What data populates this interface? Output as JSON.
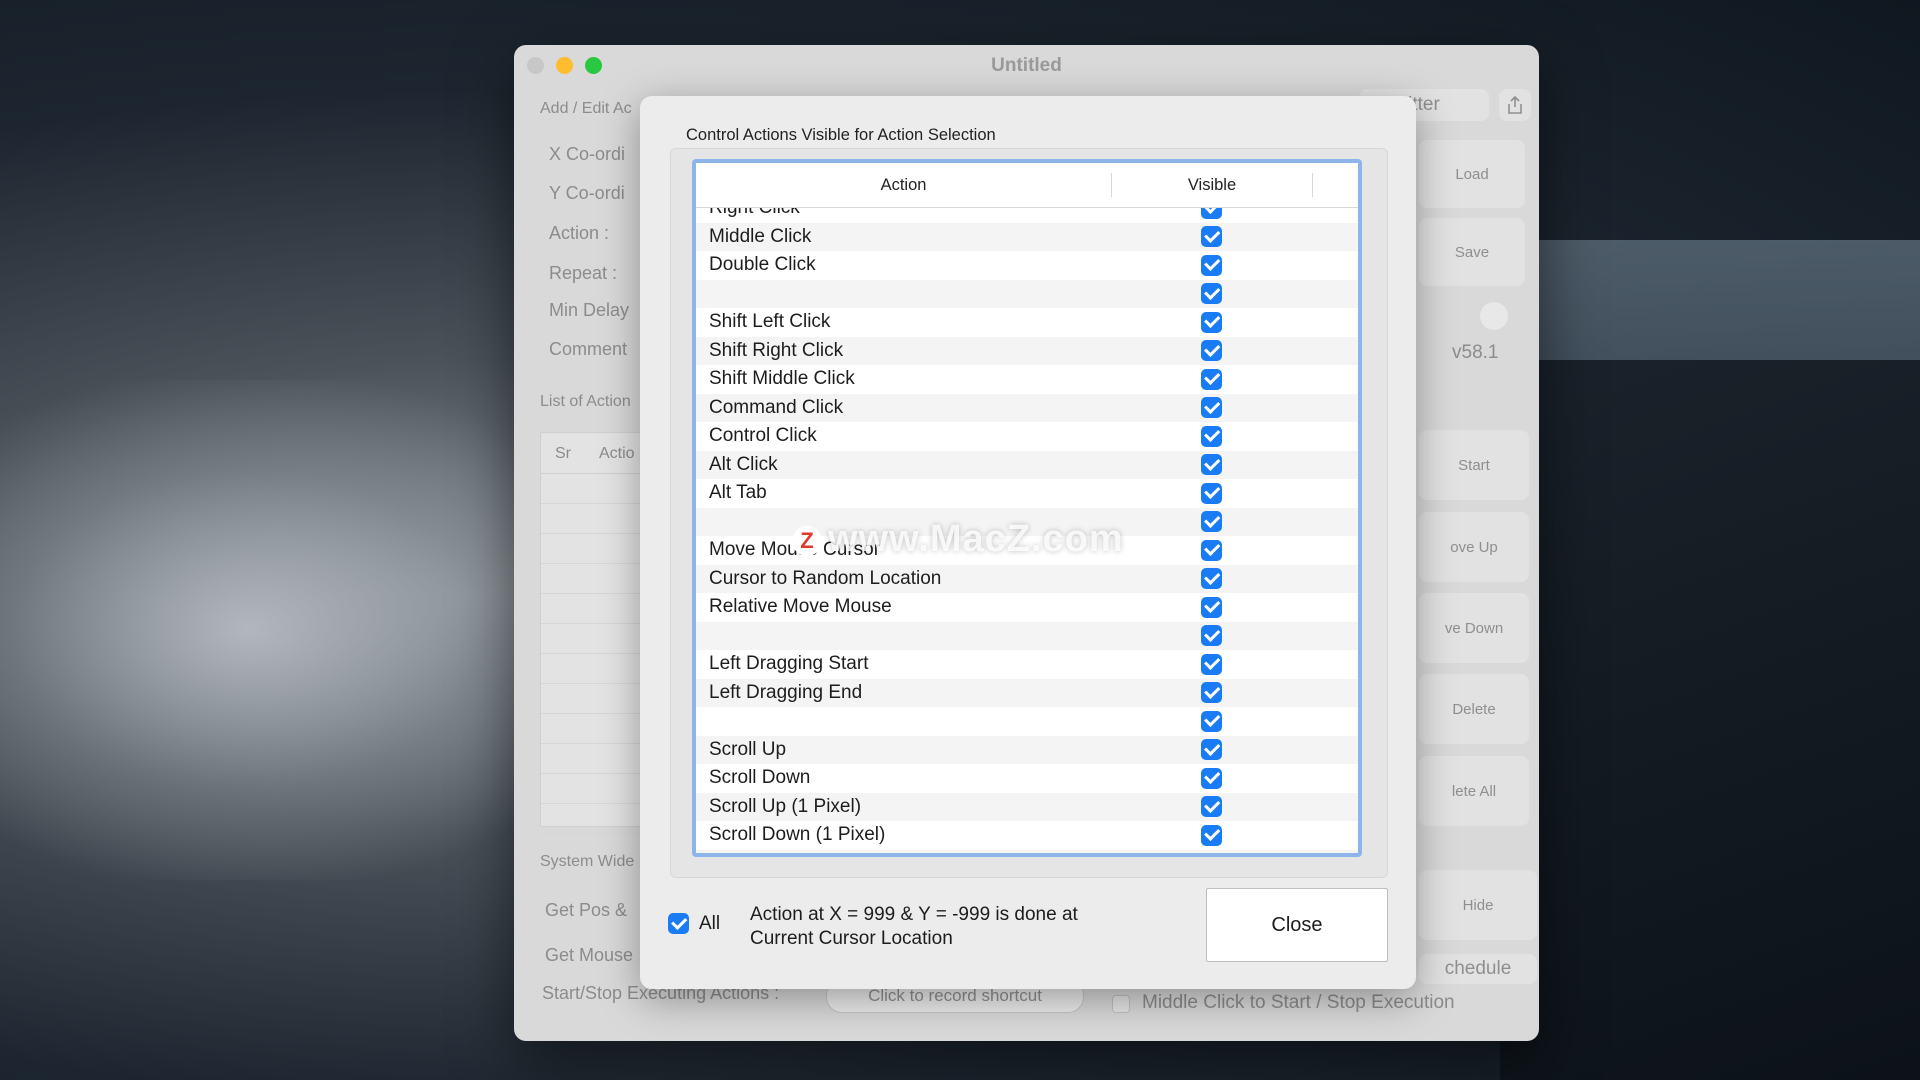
{
  "window": {
    "title": "Untitled"
  },
  "background_window": {
    "add_edit_label": "Add / Edit Ac",
    "x_label": "X Co-ordi",
    "y_label": "Y Co-ordi",
    "action_label": "Action :",
    "repeat_label": "Repeat :",
    "min_delay_label": "Min Delay",
    "comment_label": "Comment",
    "list_label": "List of Action",
    "list_col_sr": "Sr",
    "list_col_action": "Actio",
    "system_wide_label": "System Wide",
    "get_pos_label": "Get Pos &",
    "get_mouse_label": "Get Mouse",
    "start_stop_label": "Start/Stop Executing Actions :",
    "record_shortcut_label": "Click to record shortcut",
    "jitter_label": "itter",
    "load_label": "Load",
    "save_label": "Save",
    "version": "v58.1",
    "start_label": "Start",
    "move_up_label": "ove Up",
    "move_down_label": "ve Down",
    "delete_label": "Delete",
    "delete_all_label": "lete All",
    "hide_label": "Hide",
    "schedule_label": "chedule",
    "middle_click_label": "Middle Click to Start / Stop Execution"
  },
  "dialog": {
    "title": "Control Actions Visible for Action Selection",
    "columns": {
      "action": "Action",
      "visible": "Visible"
    },
    "rows": [
      {
        "action": "Right Click",
        "visible": true
      },
      {
        "action": "Middle Click",
        "visible": true
      },
      {
        "action": "Double Click",
        "visible": true
      },
      {
        "action": "",
        "visible": true
      },
      {
        "action": "Shift Left Click",
        "visible": true
      },
      {
        "action": "Shift Right Click",
        "visible": true
      },
      {
        "action": "Shift Middle Click",
        "visible": true
      },
      {
        "action": "Command Click",
        "visible": true
      },
      {
        "action": "Control Click",
        "visible": true
      },
      {
        "action": "Alt Click",
        "visible": true
      },
      {
        "action": "Alt Tab",
        "visible": true
      },
      {
        "action": "",
        "visible": true
      },
      {
        "action": "Move Mouse Cursor",
        "visible": true
      },
      {
        "action": "Cursor to Random Location",
        "visible": true
      },
      {
        "action": "Relative Move Mouse",
        "visible": true
      },
      {
        "action": "",
        "visible": true
      },
      {
        "action": "Left Dragging Start",
        "visible": true
      },
      {
        "action": "Left Dragging End",
        "visible": true
      },
      {
        "action": "",
        "visible": true
      },
      {
        "action": "Scroll Up",
        "visible": true
      },
      {
        "action": "Scroll Down",
        "visible": true
      },
      {
        "action": "Scroll Up (1 Pixel)",
        "visible": true
      },
      {
        "action": "Scroll Down (1 Pixel)",
        "visible": true
      },
      {
        "action": "",
        "visible": true
      }
    ],
    "all_label": "All",
    "note": "Action at X = 999 & Y = -999 is done at Current Cursor Location",
    "close_label": "Close"
  },
  "watermark": {
    "logo": "Z",
    "text": "www.MacZ.com"
  },
  "colors": {
    "accent": "#1a7cf5",
    "table_border": "#8eb5ea"
  }
}
